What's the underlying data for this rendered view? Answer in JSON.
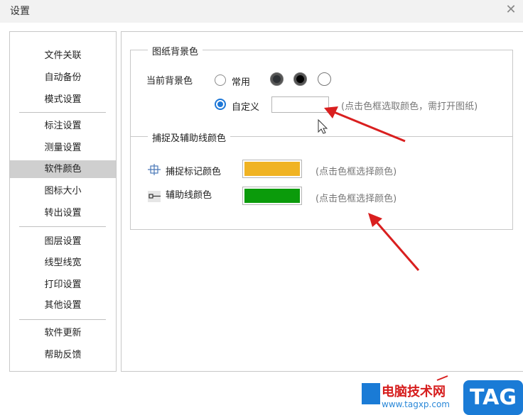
{
  "window": {
    "title": "设置"
  },
  "sidebar": {
    "items": [
      {
        "label": "文件关联"
      },
      {
        "label": "自动备份"
      },
      {
        "label": "模式设置"
      },
      {
        "label": "标注设置"
      },
      {
        "label": "测量设置"
      },
      {
        "label": "软件颜色",
        "active": true
      },
      {
        "label": "图标大小"
      },
      {
        "label": "转出设置"
      },
      {
        "label": "图层设置"
      },
      {
        "label": "线型线宽"
      },
      {
        "label": "打印设置"
      },
      {
        "label": "其他设置"
      },
      {
        "label": "软件更新"
      },
      {
        "label": "帮助反馈"
      }
    ]
  },
  "background_section": {
    "legend": "图纸背景色",
    "current_label": "当前背景色",
    "common_option": "常用",
    "custom_option": "自定义",
    "selected": "自定义",
    "preset_colors": [
      "#2e3135",
      "#000000",
      "#ffffff"
    ],
    "custom_color": "#ffffff",
    "custom_hint": "(点击色框选取颜色，需打开图纸)"
  },
  "snap_section": {
    "legend": "捕捉及辅助线颜色",
    "snap_mark_label": "捕捉标记颜色",
    "snap_mark_color": "#f0b323",
    "snap_mark_hint": "(点击色框选择颜色)",
    "guide_line_label": "辅助线颜色",
    "guide_line_color": "#0b9b0b",
    "guide_line_hint": "(点击色框选择颜色)"
  },
  "watermark": {
    "site_name": "电脑技术网",
    "url": "www.tagxp.com",
    "badge": "TAG"
  },
  "annotation_color": "#d91f1f"
}
